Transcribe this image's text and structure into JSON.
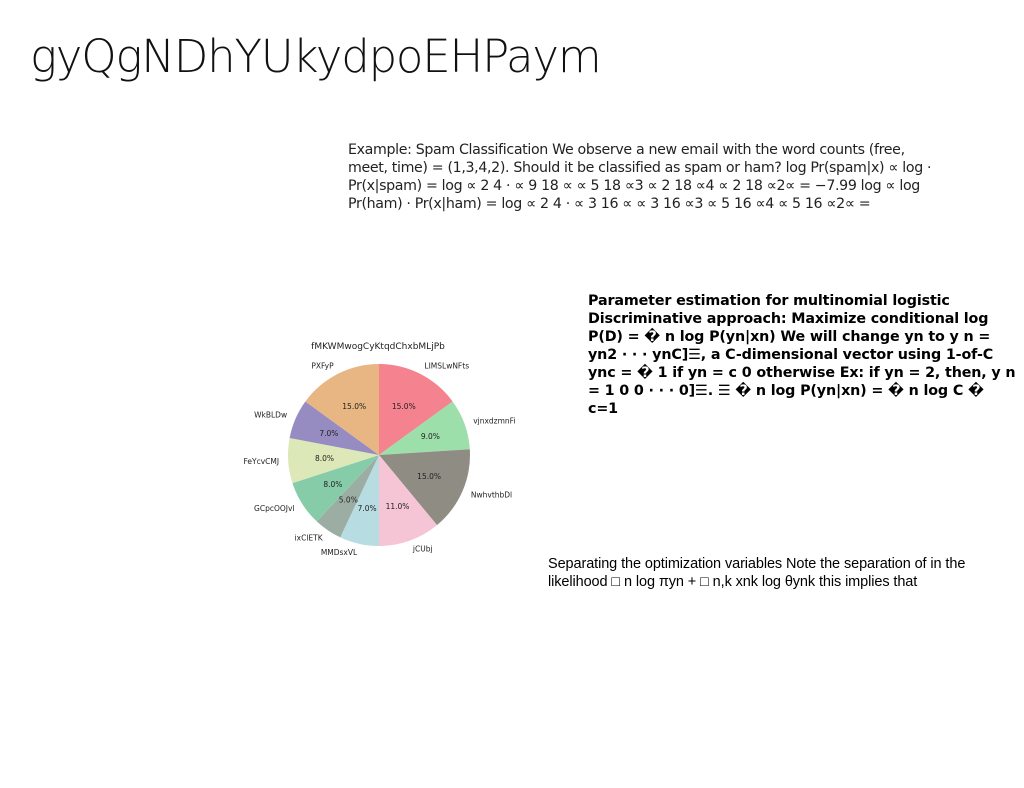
{
  "slide": {
    "title": "gyQgNDhYUkydpoEHPaym"
  },
  "blocks": {
    "example": "Example: Spam Classification We observe a new email with the word counts (free, meet, time) = (1,3,4,2). Should it be classified as spam or ham? log Pr(spam|x) ∝ log · Pr(x|spam) = log ∝ 2 4 · ∝ 9 18 ∝ ∝ 5 18 ∝3 ∝ 2 18 ∝4 ∝ 2 18 ∝2∝ = −7.99 log ∝ log Pr(ham) · Pr(x|ham) = log ∝ 2 4 · ∝ 3 16 ∝ ∝ 3 16 ∝3 ∝ 5 16 ∝4 ∝ 5 16 ∝2∝ =",
    "parameter_estimation": "Parameter estimation for multinomial logistic Discriminative approach: Maximize conditional log P(D) = � n log P(yn|xn) We will change yn to y n = yn2 · · · ynC]☰, a C-dimensional vector using 1-of-C ync = � 1 if yn = c 0 otherwise Ex: if yn = 2, then, y n = 1 0 0 · · · 0]☰. ☰ � n log P(yn|xn) = � n log C � c=1",
    "separating": "Separating the optimization variables Note the separation of in the likelihood □ n log πyn + □ n,k xnk log θynk this implies that"
  },
  "chart_data": {
    "type": "pie",
    "title": "fMKWMwogCyKtqdChxbMLjPb",
    "start_angle_deg": 90,
    "direction": "clockwise",
    "slices": [
      {
        "label": "LIMSLwNFts",
        "value": 15.0,
        "pct_label": "15.0%",
        "color": "#f4828f"
      },
      {
        "label": "vjnxdzmnFi",
        "value": 9.0,
        "pct_label": "9.0%",
        "color": "#9ddfab"
      },
      {
        "label": "NwhvthbDl",
        "value": 15.0,
        "pct_label": "15.0%",
        "color": "#8f8c84"
      },
      {
        "label": "jCUbj",
        "value": 11.0,
        "pct_label": "11.0%",
        "color": "#f6c5d5"
      },
      {
        "label": "MMDsxVL",
        "value": 7.0,
        "pct_label": "7.0%",
        "color": "#b7dde3"
      },
      {
        "label": "ixClETK",
        "value": 5.0,
        "pct_label": "5.0%",
        "color": "#9caea4"
      },
      {
        "label": "GCpcOOJvl",
        "value": 8.0,
        "pct_label": "8.0%",
        "color": "#86cca9"
      },
      {
        "label": "FeYcvCMJ",
        "value": 8.0,
        "pct_label": "8.0%",
        "color": "#dde8b8"
      },
      {
        "label": "WkBLDw",
        "value": 7.0,
        "pct_label": "7.0%",
        "color": "#968cc2"
      },
      {
        "label": "PXFyP",
        "value": 15.0,
        "pct_label": "15.0%",
        "color": "#e8b682"
      }
    ]
  }
}
